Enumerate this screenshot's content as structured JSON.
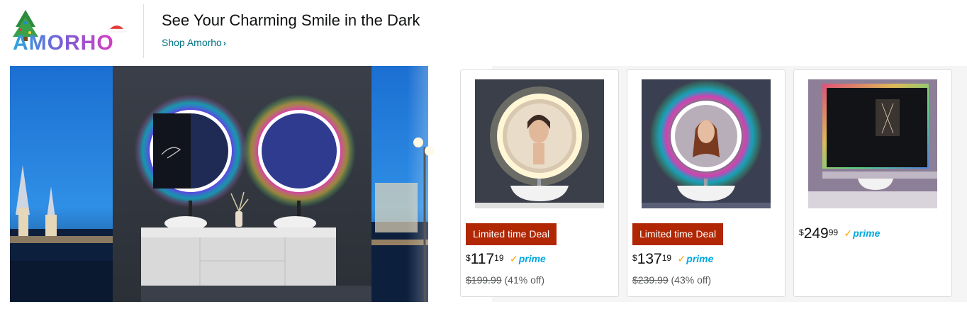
{
  "brand": {
    "logo_text": "AMORHO",
    "headline": "See Your Charming Smile in the Dark",
    "shop_link": "Shop Amorho",
    "shop_link_icon": "chevron-right-icon"
  },
  "products": [
    {
      "deal": "Limited time Deal",
      "currency": "$",
      "price_whole": "117",
      "price_fraction": "19",
      "prime_label": "prime",
      "list_price": "$199.99",
      "discount": "(41% off)"
    },
    {
      "deal": "Limited time Deal",
      "currency": "$",
      "price_whole": "137",
      "price_fraction": "19",
      "prime_label": "prime",
      "list_price": "$239.99",
      "discount": "(43% off)"
    },
    {
      "deal": "",
      "currency": "$",
      "price_whole": "249",
      "price_fraction": "99",
      "prime_label": "prime",
      "list_price": "",
      "discount": ""
    }
  ],
  "colors": {
    "link": "#007185",
    "deal_badge": "#b12704",
    "prime_blue": "#00a8e1",
    "prime_check": "#f7a700"
  }
}
